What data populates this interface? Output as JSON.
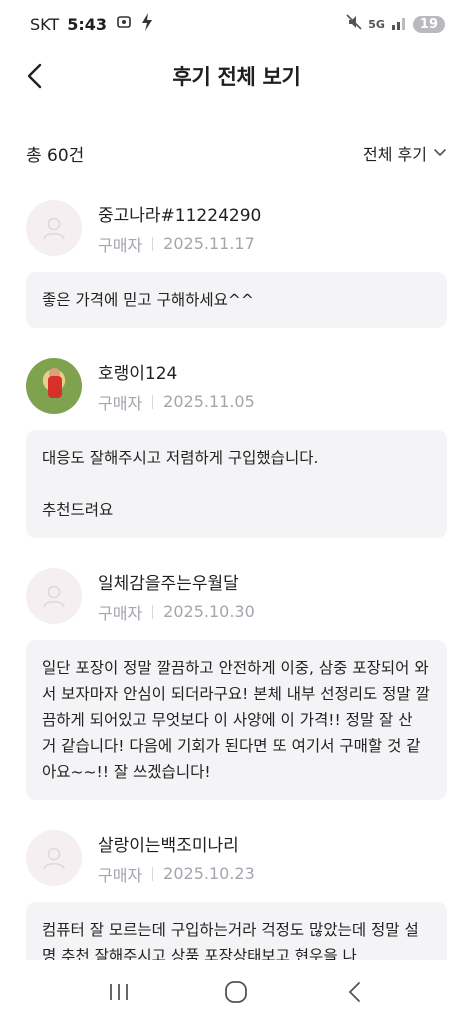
{
  "status": {
    "carrier": "SKT",
    "time": "5:43",
    "network": "5G",
    "battery": "19"
  },
  "header": {
    "title": "후기 전체 보기"
  },
  "summary": {
    "total": "총 60건",
    "filter_label": "전체 후기"
  },
  "reviews": [
    {
      "name": "중고나라#11224290",
      "role": "구매자",
      "date": "2025.11.17",
      "text": "좋은 가격에 믿고 구해하세요^^",
      "avatar": "default-avatar-icon"
    },
    {
      "name": "호랭이124",
      "role": "구매자",
      "date": "2025.11.05",
      "text": "대응도 잘해주시고 저렴하게 구입했습니다.\n\n추천드려요",
      "avatar": "photo"
    },
    {
      "name": "일체감을주는우월달",
      "role": "구매자",
      "date": "2025.10.30",
      "text": "일단 포장이 정말 깔끔하고 안전하게 이중, 삼중 포장되어 와서 보자마자 안심이 되더라구요! 본체 내부 선정리도 정말 깔끔하게 되어있고 무엇보다 이 사양에 이 가격!! 정말 잘 산 거 같습니다! 다음에 기회가 된다면 또 여기서 구매할 것 같아요~~!! 잘 쓰겠습니다!",
      "avatar": "default-avatar-icon"
    },
    {
      "name": "살랑이는백조미나리",
      "role": "구매자",
      "date": "2025.10.23",
      "text": "컴퓨터 잘 모르는데 구입하는거라 걱정도 많았는데 정말 설명 추천 잘해주시고 상품 포장상태보고 현우을 나",
      "avatar": "default-avatar-icon"
    }
  ],
  "colors": {
    "bubble": "#f4f4f6",
    "meta": "#a2a6ad",
    "avatar_bg": "#f6eff2"
  }
}
